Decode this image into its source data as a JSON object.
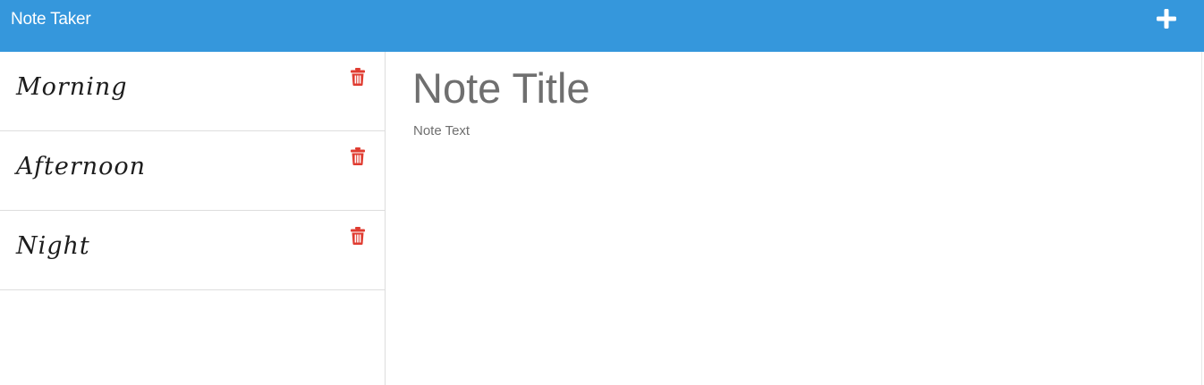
{
  "navbar": {
    "brand": "Note Taker",
    "new_note_icon": "plus-icon",
    "background": "#3597dc"
  },
  "sidebar": {
    "notes": [
      {
        "title": "Morning",
        "delete_icon": "trash-icon"
      },
      {
        "title": "Afternoon",
        "delete_icon": "trash-icon"
      },
      {
        "title": "Night",
        "delete_icon": "trash-icon"
      }
    ],
    "delete_color": "#e03c31"
  },
  "editor": {
    "title_placeholder": "Note Title",
    "text_placeholder": "Note Text"
  }
}
